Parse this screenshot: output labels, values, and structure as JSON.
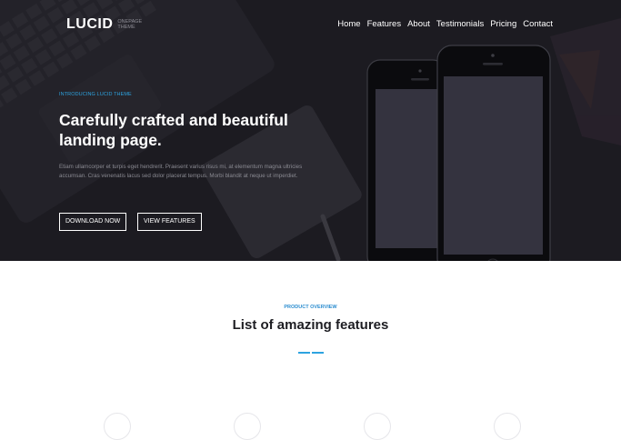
{
  "brand": {
    "logo": "LUCID",
    "tagline": "ONEPAGE THEME"
  },
  "nav": {
    "items": [
      "Home",
      "Features",
      "About",
      "Testimonials",
      "Pricing",
      "Contact"
    ]
  },
  "hero": {
    "intro": "INTRODUCING LUCID THEME",
    "headline_line1": "Carefully crafted and beautiful",
    "headline_line2": "landing page.",
    "description": "Etiam ullamcorper et turpis eget hendrerit. Praesent varius risus mi, at elementum magna ultricies accumsan. Cras venenatis lacus sed dolor placerat tempus. Morbi blandit at neque ut imperdiet.",
    "download_label": "DOWNLOAD NOW",
    "features_label": "VIEW FEATURES"
  },
  "overview": {
    "label": "PRODUCT OVERVIEW",
    "title": "List of amazing features"
  },
  "colors": {
    "accent": "#2da3e0",
    "hero_bg": "#1c1b21"
  }
}
